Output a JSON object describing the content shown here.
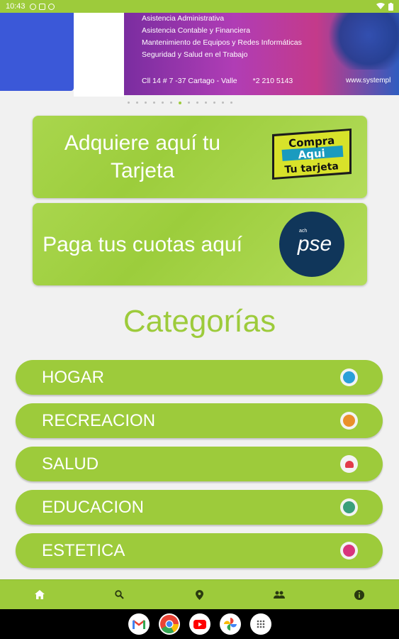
{
  "status_bar": {
    "time": "10:43"
  },
  "banner": {
    "lines": [
      "Asistencia Administrativa",
      "Asistencia Contable y Financiera",
      "Mantenimiento de Equipos y Redes Informáticas",
      "Seguridad y Salud en el Trabajo"
    ],
    "address": "Cll 14 # 7 -37  Cartago - Valle",
    "phone": "*2 210 5143",
    "url": "www.systempl",
    "dot_count": 13,
    "active_dot": 6
  },
  "cards": [
    {
      "label": "Adquiere aquí tu Tarjeta",
      "logo": {
        "line1": "Compra",
        "line2": "Aqui",
        "line3": "Tu tarjeta"
      }
    },
    {
      "label": "Paga tus cuotas aquí",
      "logo": {
        "small": "ach",
        "text": "pse"
      }
    }
  ],
  "categories_title": "Categorías",
  "categories": [
    {
      "label": "HOGAR",
      "icon": "home-icon",
      "color": "#2a9fd8"
    },
    {
      "label": "RECREACION",
      "icon": "recreation-icon",
      "color": "#e9902a"
    },
    {
      "label": "SALUD",
      "icon": "heart-icon",
      "color": "#e23b4a"
    },
    {
      "label": "EDUCACION",
      "icon": "graduation-icon",
      "color": "#3a9f7a"
    },
    {
      "label": "ESTETICA",
      "icon": "beauty-icon",
      "color": "#d8357c"
    }
  ],
  "bottom_nav": [
    {
      "icon": "home-icon"
    },
    {
      "icon": "search-icon"
    },
    {
      "icon": "location-pin-icon"
    },
    {
      "icon": "people-icon"
    },
    {
      "icon": "info-icon"
    }
  ],
  "taskbar_apps": [
    "gmail-icon",
    "chrome-icon",
    "youtube-icon",
    "photos-icon",
    "app-drawer-icon"
  ],
  "colors": {
    "accent": "#9dcb3b",
    "background": "#f1f1f1"
  }
}
